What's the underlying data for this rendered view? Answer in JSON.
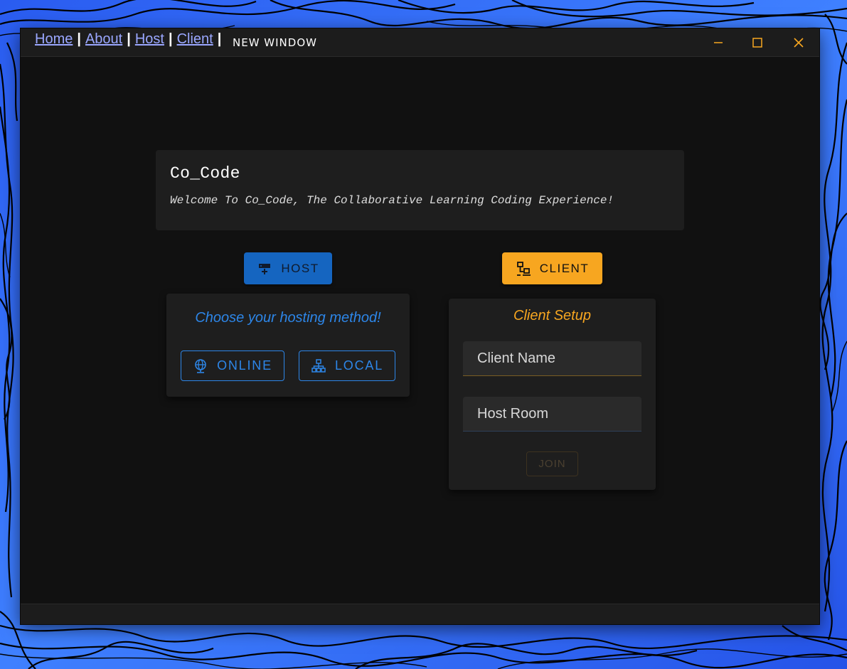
{
  "desktop": {
    "wallpaper_colors": [
      "#2a5cf0",
      "#4a8cff",
      "#000000"
    ]
  },
  "window": {
    "nav": [
      {
        "label": "Home"
      },
      {
        "label": "About"
      },
      {
        "label": "Host"
      },
      {
        "label": "Client"
      }
    ],
    "separator": "|",
    "new_window_label": "NEW WINDOW",
    "controls": {
      "minimize_icon": "minimize-icon",
      "maximize_icon": "maximize-icon",
      "close_icon": "close-icon",
      "color": "#f7a620"
    }
  },
  "welcome": {
    "title": "Co_Code",
    "subtitle": "Welcome To Co_Code, The Collaborative Learning Coding Experience!"
  },
  "host": {
    "button_label": "HOST",
    "button_icon": "server-icon",
    "heading": "Choose your hosting method!",
    "online_label": "ONLINE",
    "online_icon": "globe-icon",
    "local_label": "LOCAL",
    "local_icon": "network-icon",
    "accent": "#1565c0"
  },
  "client": {
    "button_label": "CLIENT",
    "button_icon": "computers-icon",
    "heading": "Client Setup",
    "client_name_placeholder": "Client Name",
    "host_room_placeholder": "Host Room",
    "join_label": "JOIN",
    "accent": "#f7a620"
  }
}
